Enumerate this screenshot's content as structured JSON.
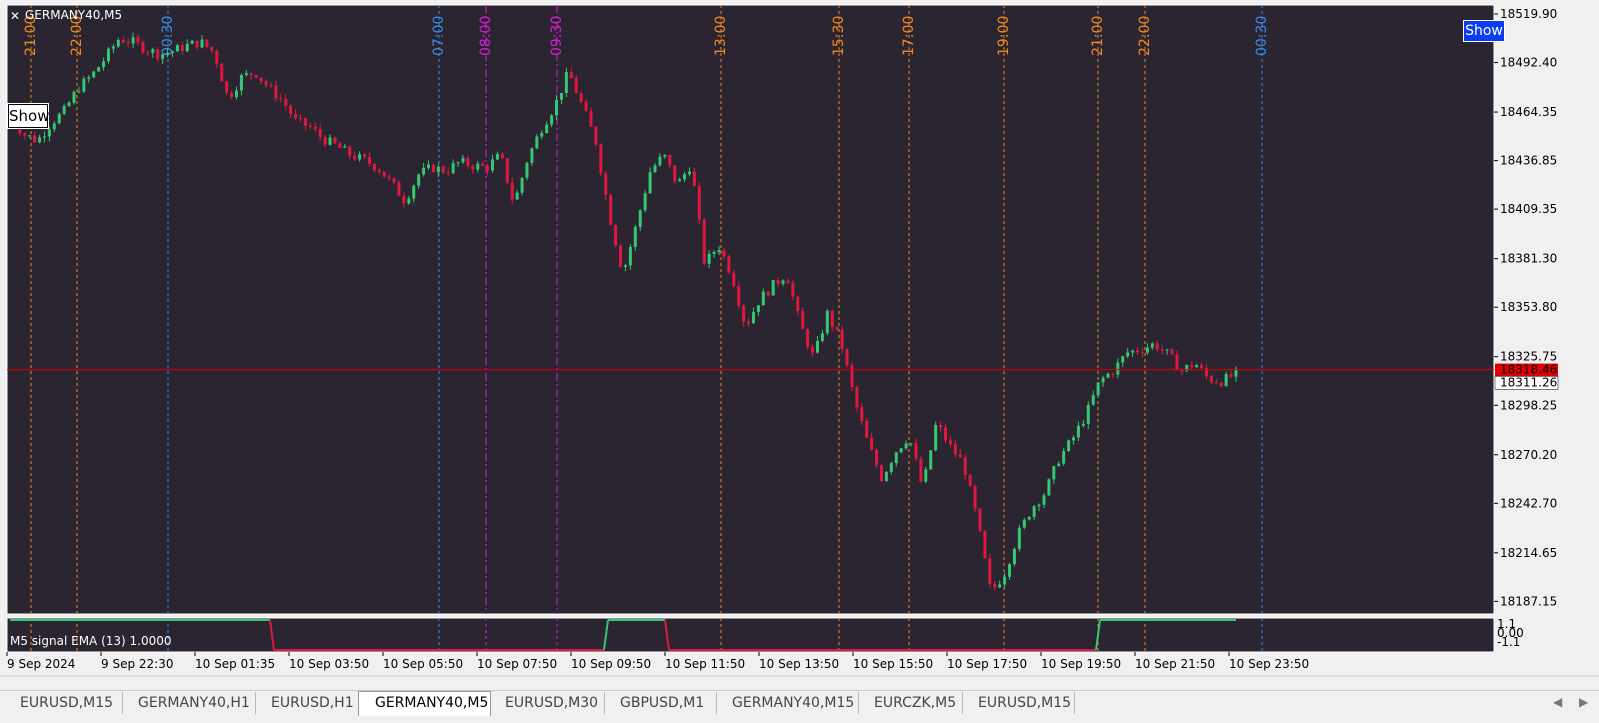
{
  "window": {
    "symbol": "GERMANY40,M5",
    "show_left_label": "Show",
    "show_right_label": "Show"
  },
  "colors": {
    "background": "#2a2530",
    "bull": "#34c873",
    "bear": "#e01840",
    "price_line": "#e00000",
    "bid_tag": "#e00000",
    "orange_line": "#f08a20",
    "blue_line": "#3b8ce8",
    "magenta_line": "#d41ed4"
  },
  "price_axis": {
    "labels": [
      "18519.90",
      "18492.40",
      "18464.35",
      "18436.85",
      "18409.35",
      "18381.30",
      "18353.80",
      "18325.75",
      "18298.25",
      "18270.20",
      "18242.70",
      "18214.65",
      "18187.15"
    ],
    "bid_price": "18318.46",
    "last_price": "18311.26"
  },
  "session_lines": [
    {
      "label": "21:00",
      "color": "orange"
    },
    {
      "label": "22:00",
      "color": "orange"
    },
    {
      "label": "00:30",
      "color": "blue"
    },
    {
      "label": "07:00",
      "color": "blue"
    },
    {
      "label": "08:00",
      "color": "magenta"
    },
    {
      "label": "09:30",
      "color": "magenta"
    },
    {
      "label": "13:00",
      "color": "orange"
    },
    {
      "label": "15:30",
      "color": "orange"
    },
    {
      "label": "17:00",
      "color": "orange"
    },
    {
      "label": "19:00",
      "color": "orange"
    },
    {
      "label": "21:00",
      "color": "orange"
    },
    {
      "label": "22:00",
      "color": "orange"
    },
    {
      "label": "00:30",
      "color": "blue"
    }
  ],
  "time_axis": [
    "9 Sep 2024",
    "9 Sep 22:30",
    "10 Sep 01:35",
    "10 Sep 03:50",
    "10 Sep 05:50",
    "10 Sep 07:50",
    "10 Sep 09:50",
    "10 Sep 11:50",
    "10 Sep 13:50",
    "10 Sep 15:50",
    "10 Sep 17:50",
    "10 Sep 19:50",
    "10 Sep 21:50",
    "10 Sep 23:50"
  ],
  "indicator": {
    "label": "M5 signal EMA (13) 1.0000",
    "axis_labels": [
      "1.1",
      "0.00",
      "-1.1"
    ]
  },
  "tabs": [
    {
      "label": "EURUSD,M15",
      "active": false
    },
    {
      "label": "GERMANY40,H1",
      "active": false
    },
    {
      "label": "EURUSD,H1",
      "active": false
    },
    {
      "label": "GERMANY40,M5",
      "active": true
    },
    {
      "label": "EURUSD,M30",
      "active": false
    },
    {
      "label": "GBPUSD,M1",
      "active": false
    },
    {
      "label": "GERMANY40,M15",
      "active": false
    },
    {
      "label": "EURCZK,M5",
      "active": false
    },
    {
      "label": "EURUSD,M15",
      "active": false
    }
  ],
  "chart_data": {
    "type": "candlestick",
    "y_range": [
      18180,
      18525
    ],
    "close_path": [
      18462,
      18452,
      18448,
      18458,
      18465,
      18478,
      18485,
      18495,
      18506,
      18504,
      18500,
      18497,
      18499,
      18502,
      18504,
      18498,
      18472,
      18484,
      18487,
      18478,
      18471,
      18459,
      18456,
      18449,
      18445,
      18440,
      18437,
      18433,
      18424,
      18414,
      18429,
      18433,
      18431,
      18436,
      18434,
      18433,
      18440,
      18412,
      18438,
      18455,
      18468,
      18487,
      18468,
      18448,
      18406,
      18373,
      18401,
      18431,
      18440,
      18423,
      18435,
      18378,
      18389,
      18372,
      18343,
      18358,
      18366,
      18373,
      18344,
      18325,
      18350,
      18334,
      18301,
      18276,
      18257,
      18272,
      18281,
      18251,
      18288,
      18275,
      18265,
      18233,
      18192,
      18203,
      18225,
      18240,
      18249,
      18268,
      18279,
      18293,
      18312,
      18318,
      18328,
      18330,
      18333,
      18327,
      18318,
      18322,
      18313,
      18312,
      18316
    ]
  }
}
